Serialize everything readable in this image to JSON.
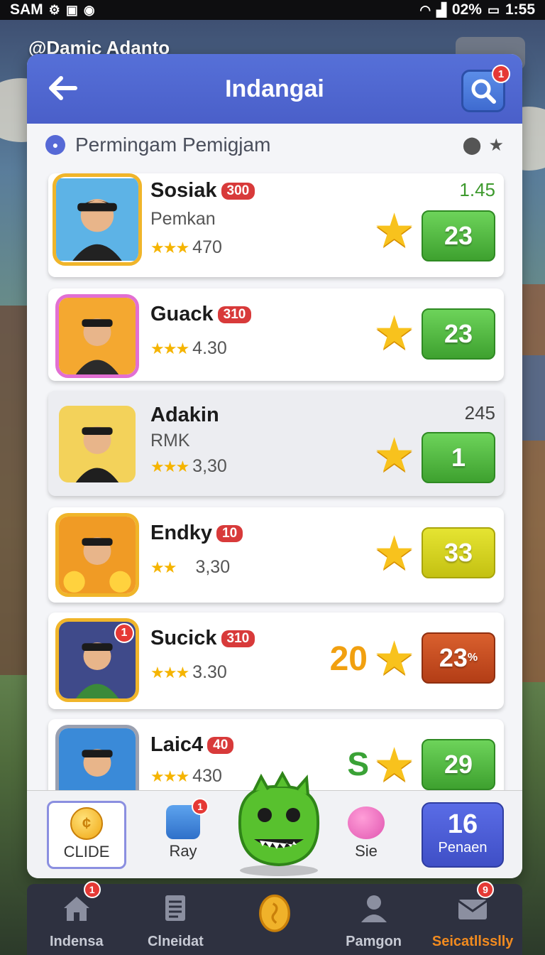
{
  "status_bar": {
    "carrier": "SAM",
    "left_icons": [
      "settings-icon",
      "signal-icon",
      "app-icon",
      "camera-icon",
      "chat-icon"
    ],
    "right_icons": [
      "wifi-icon",
      "signal-bars-icon",
      "battery-icon"
    ],
    "battery": "02%",
    "time": "1:55"
  },
  "behind": {
    "title": "@Damic Adanto"
  },
  "header": {
    "title": "Indangai",
    "search_badge": "1"
  },
  "subheader": {
    "title": "Permingam Pemigjam"
  },
  "rows": [
    {
      "name": "Sosiak",
      "tag": "300",
      "subtitle": "Pemkan",
      "stars": "★★★",
      "rating": "470",
      "top_value": "1.45",
      "pill": "23",
      "pill_color": "green"
    },
    {
      "name": "Guack",
      "tag": "310",
      "subtitle": "",
      "stars": "★★★",
      "rating": "4.30",
      "top_value": "",
      "pill": "23",
      "pill_color": "green"
    },
    {
      "name": "Adakin",
      "tag": "",
      "subtitle": "RMK",
      "stars": "★★★",
      "rating": "3,30",
      "top_value": "245",
      "pill": "1",
      "pill_color": "green"
    },
    {
      "name": "Endky",
      "tag": "10",
      "subtitle": "",
      "stars": "★★",
      "rating": "3,30",
      "top_value": "",
      "pill": "33",
      "pill_color": "yellow"
    },
    {
      "name": "Sucick",
      "tag": "310",
      "subtitle": "",
      "stars": "★★★",
      "rating": "3.30",
      "top_value": "",
      "pill": "23",
      "pill_sup": "%",
      "pill_color": "red",
      "score": "20",
      "avatar_badge": "1"
    },
    {
      "name": "Laic4",
      "tag": "40",
      "subtitle": "",
      "stars": "★★★",
      "rating": "430",
      "top_value": "",
      "pill": "29",
      "pill_color": "green",
      "currency": "S"
    }
  ],
  "tray": {
    "clide_label": "CLIDE",
    "ray_label": "Ray",
    "ray_badge": "1",
    "sie_label": "Sie",
    "penaen_num": "16",
    "penaen_label": "Penaen"
  },
  "nav": [
    {
      "label": "Indensa",
      "icon": "home-icon",
      "badge": "1"
    },
    {
      "label": "Clneidat",
      "icon": "document-icon",
      "badge": ""
    },
    {
      "label": "",
      "icon": "coin-icon",
      "badge": ""
    },
    {
      "label": "Pamgon",
      "icon": "user-icon",
      "badge": ""
    },
    {
      "label": "Seicatllsslly",
      "icon": "mail-icon",
      "badge": "9"
    }
  ],
  "colors": {
    "header": "#4a5fc9",
    "accent_green": "#3ea12f",
    "accent_orange": "#f28b1f",
    "badge_red": "#e53935"
  }
}
